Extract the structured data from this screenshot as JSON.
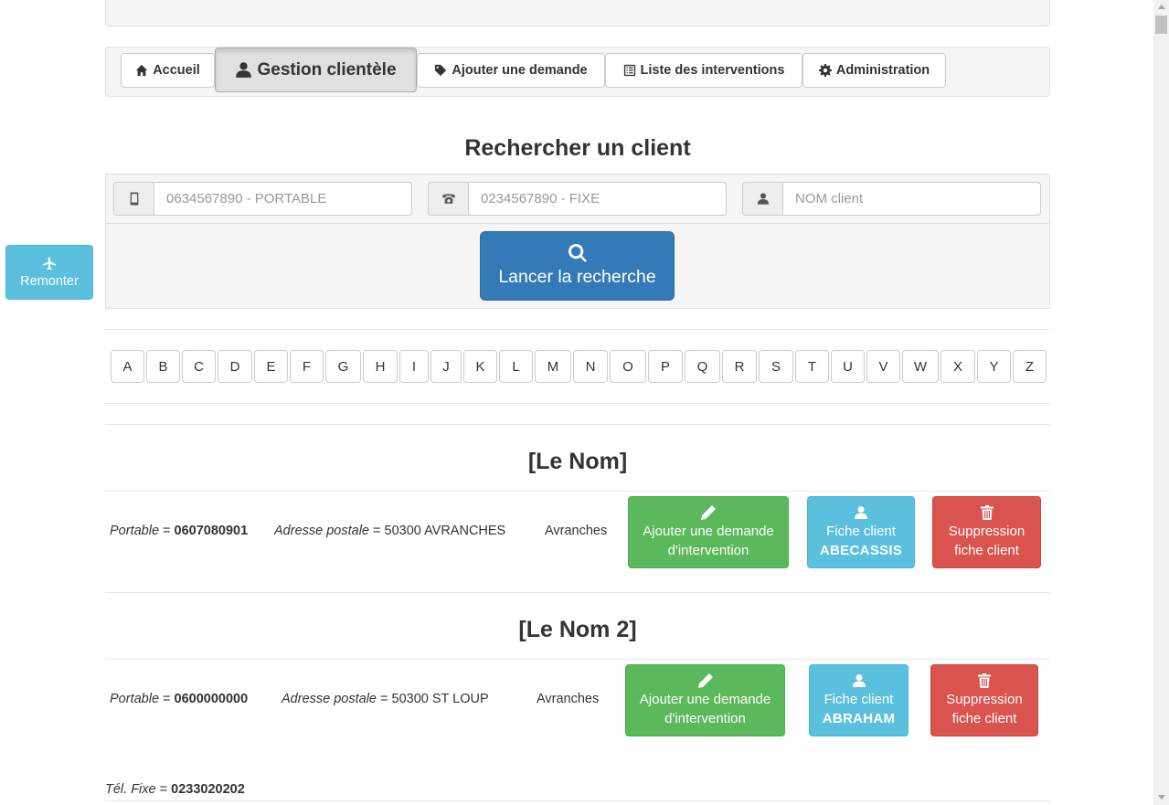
{
  "nav": {
    "home": "Accueil",
    "clients": "Gestion clientèle",
    "add_request": "Ajouter une demande",
    "interventions": "Liste des interventions",
    "admin": "Administration"
  },
  "search": {
    "title": "Rechercher un client",
    "mobile_placeholder": "0634567890 - PORTABLE",
    "fixed_placeholder": "0234567890 - FIXE",
    "name_placeholder": "NOM client",
    "button_label": "Lancer la recherche"
  },
  "back_to_top": "Remonter",
  "alphabet": [
    "A",
    "B",
    "C",
    "D",
    "E",
    "F",
    "G",
    "H",
    "I",
    "J",
    "K",
    "L",
    "M",
    "N",
    "O",
    "P",
    "Q",
    "R",
    "S",
    "T",
    "U",
    "V",
    "W",
    "X",
    "Y",
    "Z"
  ],
  "clients": [
    {
      "name": "[Le Nom]",
      "mobile_label": "Portable",
      "mobile": "0607080901",
      "address_label": "Adresse postale",
      "address": "50300 AVRANCHES",
      "city": "Avranches",
      "add_request_line1": "Ajouter une demande",
      "add_request_line2": "d'intervention",
      "card_line1": "Fiche client",
      "card_name": "ABECASSIS",
      "delete_line1": "Suppression",
      "delete_line2": "fiche client"
    },
    {
      "name": "[Le Nom 2]",
      "mobile_label": "Portable",
      "mobile": "0600000000",
      "address_label": "Adresse postale",
      "address": "50300 ST LOUP",
      "city": "Avranches",
      "add_request_line1": "Ajouter une demande",
      "add_request_line2": "d'intervention",
      "card_line1": "Fiche client",
      "card_name": "ABRAHAM",
      "delete_line1": "Suppression",
      "delete_line2": "fiche client",
      "fixed_label": "Tél. Fixe",
      "fixed": "0233020202"
    }
  ],
  "equals": "="
}
